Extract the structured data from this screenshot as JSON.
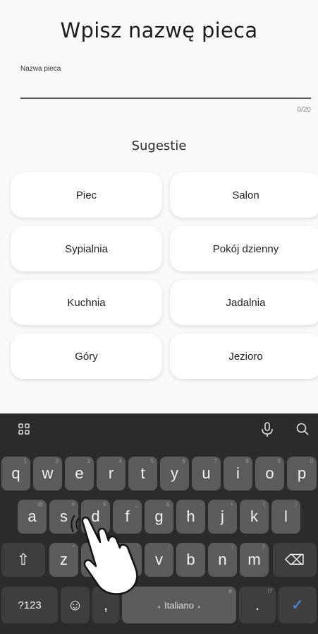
{
  "screen": {
    "title": "Wpisz nazwę pieca",
    "field_label": "Nazwa pieca",
    "field_value": "",
    "counter": "0/20",
    "suggestions_title": "Sugestie",
    "suggestions": [
      "Piec",
      "Salon",
      "Sypialnia",
      "Pokój dzienny",
      "Kuchnia",
      "Jadalnia",
      "Góry",
      "Jezioro"
    ]
  },
  "keyboard": {
    "toolbar": {
      "left_icon": "grid-icon",
      "mic_icon": "mic-icon",
      "search_icon": "search-icon"
    },
    "row1": [
      {
        "k": "q",
        "h": "1"
      },
      {
        "k": "w",
        "h": "2"
      },
      {
        "k": "e",
        "h": "3"
      },
      {
        "k": "r",
        "h": "4"
      },
      {
        "k": "t",
        "h": "5"
      },
      {
        "k": "y",
        "h": "6"
      },
      {
        "k": "u",
        "h": "7"
      },
      {
        "k": "i",
        "h": "8"
      },
      {
        "k": "o",
        "h": "9"
      },
      {
        "k": "p",
        "h": "0"
      }
    ],
    "row2": [
      {
        "k": "a",
        "h": "@"
      },
      {
        "k": "s",
        "h": "#"
      },
      {
        "k": "d",
        "h": "€"
      },
      {
        "k": "f",
        "h": "_"
      },
      {
        "k": "g",
        "h": "&"
      },
      {
        "k": "h",
        "h": "-"
      },
      {
        "k": "j",
        "h": "+"
      },
      {
        "k": "k",
        "h": "("
      },
      {
        "k": "l",
        "h": ")"
      }
    ],
    "row3": [
      {
        "k": "z",
        "h": "*"
      },
      {
        "k": "x",
        "h": "\""
      },
      {
        "k": "c",
        "h": "'"
      },
      {
        "k": "v",
        "h": ":"
      },
      {
        "k": "b",
        "h": ";"
      },
      {
        "k": "n",
        "h": "!"
      },
      {
        "k": "m",
        "h": "?"
      }
    ],
    "shift": "⇧",
    "backspace": "⌫",
    "symbols": "?123",
    "emoji": "☺",
    "comma": ",",
    "space": "Italiano",
    "period": ".",
    "period_hint": "!?",
    "enter": "✓"
  }
}
